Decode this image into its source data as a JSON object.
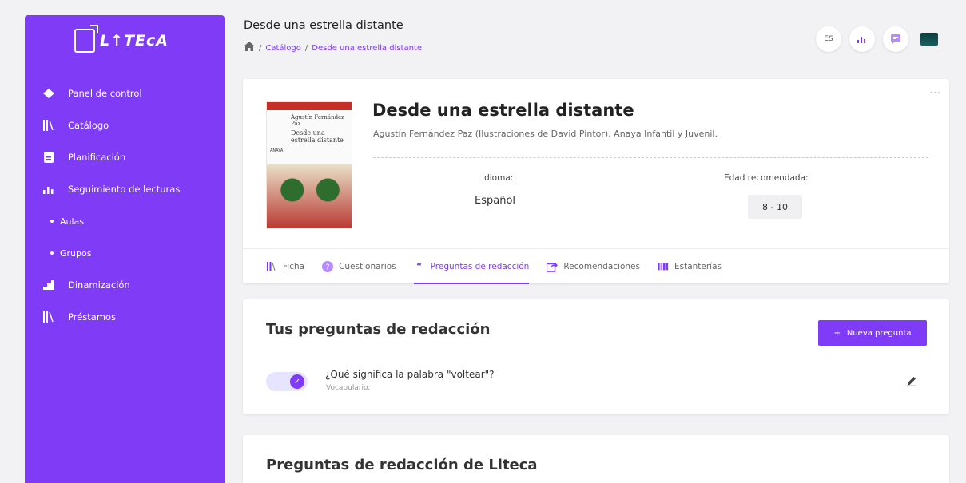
{
  "sidebar": {
    "logo_text": "L↑TEcA",
    "items": [
      {
        "label": "Panel de control",
        "icon": "diamond-icon"
      },
      {
        "label": "Catálogo",
        "icon": "books-icon"
      },
      {
        "label": "Planificación",
        "icon": "document-icon"
      },
      {
        "label": "Seguimiento de lecturas",
        "icon": "bar-chart-icon"
      },
      {
        "label": "Aulas",
        "icon": "dot-icon"
      },
      {
        "label": "Grupos",
        "icon": "dot-icon"
      },
      {
        "label": "Dinamización",
        "icon": "steps-icon"
      },
      {
        "label": "Préstamos",
        "icon": "books-icon"
      }
    ]
  },
  "header": {
    "title": "Desde una estrella distante",
    "breadcrumb": [
      "Catálogo",
      "Desde una estrella distante"
    ],
    "language": "ES"
  },
  "book": {
    "cover_author": "Agustín Fernández Paz",
    "cover_title": "Desde una estrella distante",
    "cover_publisher": "ANAYA",
    "title": "Desde una estrella distante",
    "author": "Agustín Fernández Paz (Ilustraciones de David Pintor). Anaya Infantil y Juvenil.",
    "language_label": "Idioma:",
    "language_value": "Español",
    "age_label": "Edad recomendada:",
    "age_value": "8 - 10"
  },
  "tabs": [
    {
      "label": "Ficha",
      "icon": "books-icon"
    },
    {
      "label": "Cuestionarios",
      "icon": "question-icon"
    },
    {
      "label": "Preguntas de redacción",
      "icon": "quote-icon",
      "active": true
    },
    {
      "label": "Recomendaciones",
      "icon": "share-icon"
    },
    {
      "label": "Estanterías",
      "icon": "shelf-icon"
    }
  ],
  "questions": {
    "title": "Tus preguntas de redacción",
    "new_button": "Nueva pregunta",
    "items": [
      {
        "text": "¿Qué significa la palabra \"voltear\"?",
        "category": "Vocabulario."
      }
    ]
  },
  "liteca": {
    "title": "Preguntas de redacción de Liteca"
  },
  "colors": {
    "accent": "#7f3bf5"
  }
}
